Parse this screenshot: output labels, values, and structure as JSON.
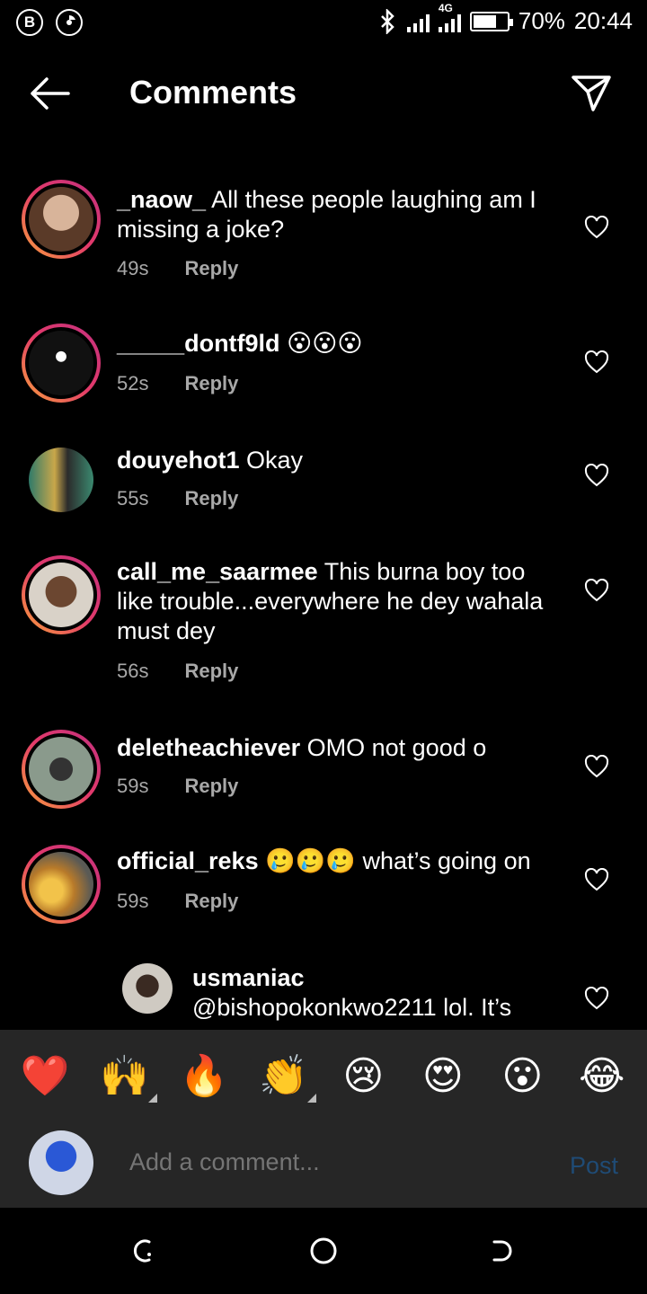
{
  "status_bar": {
    "left_icons": [
      "b-app-icon",
      "browser-icon"
    ],
    "network": "4G",
    "battery": "70%",
    "battery_level": 0.7,
    "time": "20:44"
  },
  "header": {
    "title": "Comments"
  },
  "comments": [
    {
      "user": "_naow_",
      "text": "All these people laughing am I missing a joke?",
      "time": "49s",
      "reply": "Reply",
      "story_ring": true
    },
    {
      "user": "_____dontf9ld",
      "text": "😮😮😮",
      "time": "52s",
      "reply": "Reply",
      "story_ring": true
    },
    {
      "user": "douyehot1",
      "text": "Okay",
      "time": "55s",
      "reply": "Reply",
      "story_ring": false
    },
    {
      "user": "call_me_saarmee",
      "text": "This burna boy too like trouble...everywhere he dey wahala must dey",
      "time": "56s",
      "reply": "Reply",
      "story_ring": true
    },
    {
      "user": "deletheachiever",
      "text": "OMO not good o",
      "time": "59s",
      "reply": "Reply",
      "story_ring": true
    },
    {
      "user": "official_reks",
      "text": "🥲🥲🥲 what’s going on",
      "time": "59s",
      "reply": "Reply",
      "story_ring": true
    },
    {
      "user": "usmaniac",
      "text": "@bishopokonkwo2211 lol. It’s",
      "time": "",
      "reply": "",
      "story_ring": false
    }
  ],
  "reactions": [
    "❤️",
    "🙌",
    "🔥",
    "👏",
    "😢",
    "😍",
    "😮",
    "😂"
  ],
  "composer": {
    "placeholder": "Add a comment...",
    "post_label": "Post"
  },
  "colors": {
    "background": "#000000",
    "muted_text": "#a8a8a8",
    "bar": "#262626",
    "post_disabled": "#1f4b75",
    "ring_start": "#f9a23b",
    "ring_end": "#c2307f"
  }
}
